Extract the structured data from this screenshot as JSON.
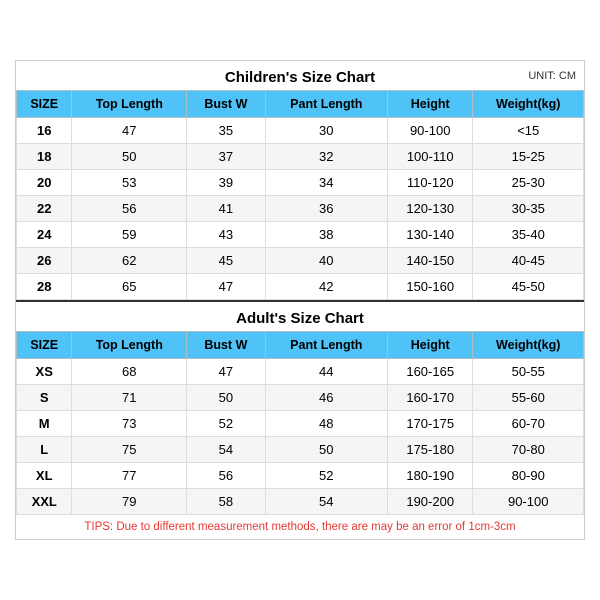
{
  "children_title": "Children's Size Chart",
  "adult_title": "Adult's Size Chart",
  "unit": "UNIT: CM",
  "tips": "TIPS: Due to different measurement methods, there are may be an error of 1cm-3cm",
  "headers": [
    "SIZE",
    "Top Length",
    "Bust W",
    "Pant Length",
    "Height",
    "Weight(kg)"
  ],
  "children_rows": [
    [
      "16",
      "47",
      "35",
      "30",
      "90-100",
      "<15"
    ],
    [
      "18",
      "50",
      "37",
      "32",
      "100-110",
      "15-25"
    ],
    [
      "20",
      "53",
      "39",
      "34",
      "110-120",
      "25-30"
    ],
    [
      "22",
      "56",
      "41",
      "36",
      "120-130",
      "30-35"
    ],
    [
      "24",
      "59",
      "43",
      "38",
      "130-140",
      "35-40"
    ],
    [
      "26",
      "62",
      "45",
      "40",
      "140-150",
      "40-45"
    ],
    [
      "28",
      "65",
      "47",
      "42",
      "150-160",
      "45-50"
    ]
  ],
  "adult_rows": [
    [
      "XS",
      "68",
      "47",
      "44",
      "160-165",
      "50-55"
    ],
    [
      "S",
      "71",
      "50",
      "46",
      "160-170",
      "55-60"
    ],
    [
      "M",
      "73",
      "52",
      "48",
      "170-175",
      "60-70"
    ],
    [
      "L",
      "75",
      "54",
      "50",
      "175-180",
      "70-80"
    ],
    [
      "XL",
      "77",
      "56",
      "52",
      "180-190",
      "80-90"
    ],
    [
      "XXL",
      "79",
      "58",
      "54",
      "190-200",
      "90-100"
    ]
  ]
}
